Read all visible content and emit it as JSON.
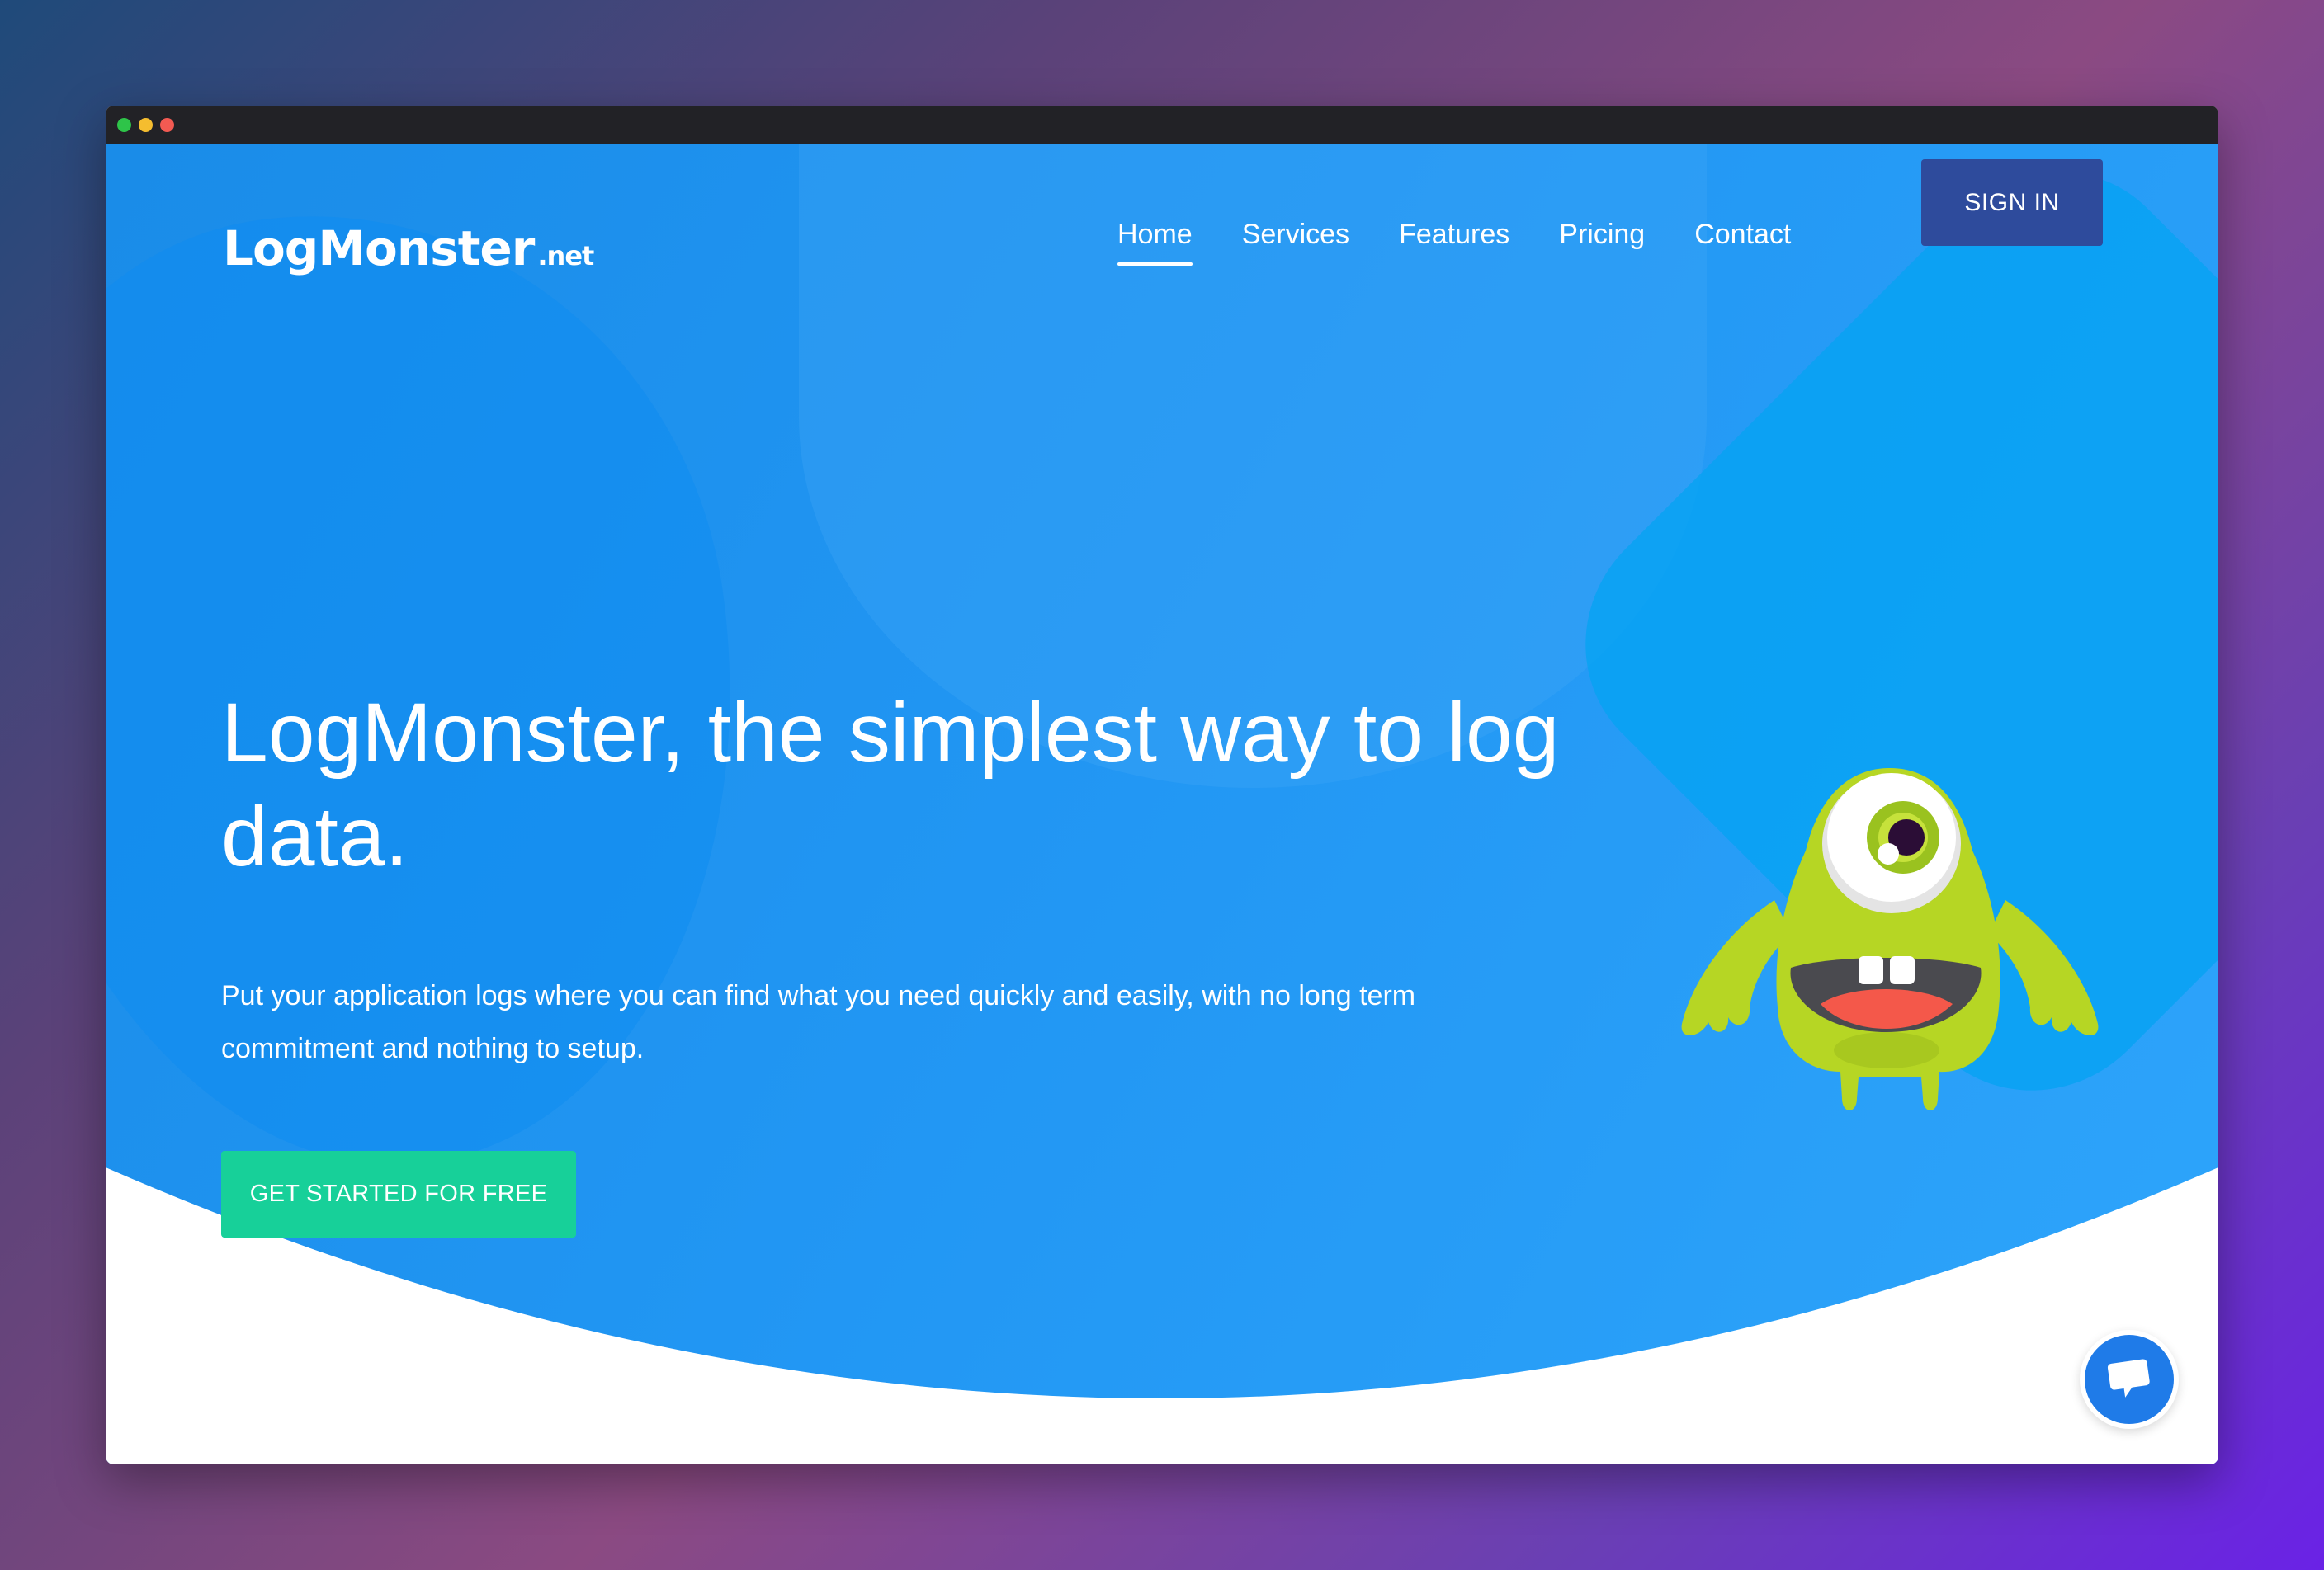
{
  "brand": {
    "name": "LogMonster",
    "tld": ".net"
  },
  "nav": {
    "items": [
      {
        "label": "Home",
        "active": true
      },
      {
        "label": "Services"
      },
      {
        "label": "Features"
      },
      {
        "label": "Pricing"
      },
      {
        "label": "Contact"
      }
    ],
    "signin_label": "SIGN IN"
  },
  "hero": {
    "headline": "LogMonster, the simplest way to log data.",
    "subtext": "Put your application logs where you can find what you need quickly and easily, with no long term commitment and nothing to setup.",
    "cta_label": "GET STARTED FOR FREE"
  },
  "icons": {
    "mascot": "monster-mascot",
    "chat": "chat-icon"
  },
  "colors": {
    "hero_blue": "#2196f3",
    "signin_bg": "#2e4b9c",
    "cta_bg": "#17d099",
    "chat_bg": "#1f7be8"
  }
}
